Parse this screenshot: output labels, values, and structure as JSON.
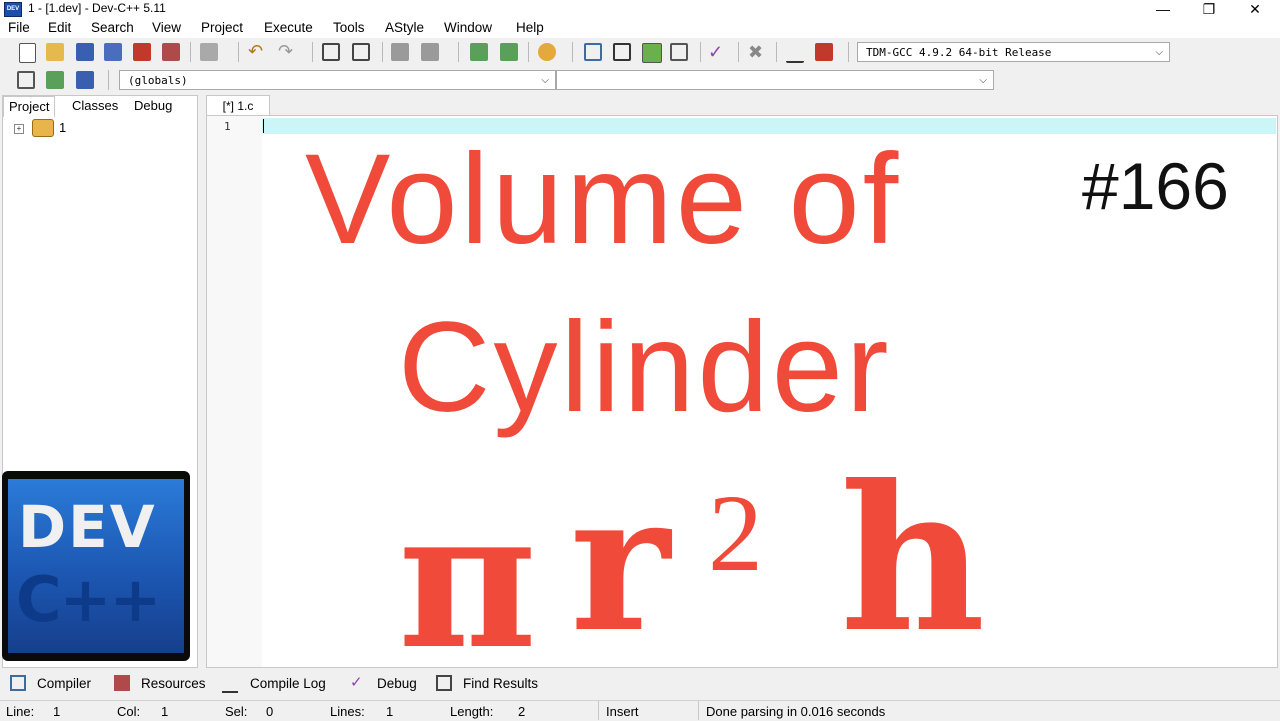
{
  "window": {
    "title": "1 - [1.dev] - Dev-C++ 5.11",
    "minimize_glyph": "—",
    "restore_glyph": "❐",
    "close_glyph": "✕"
  },
  "menu": [
    "File",
    "Edit",
    "Search",
    "View",
    "Project",
    "Execute",
    "Tools",
    "AStyle",
    "Window",
    "Help"
  ],
  "toolbar": {
    "compiler_select": "TDM-GCC 4.9.2 64-bit Release",
    "scope_select": "(globals)",
    "member_select": ""
  },
  "left_panel": {
    "tabs": [
      "Project",
      "Classes",
      "Debug"
    ],
    "tree": {
      "expander": "+",
      "label": "1"
    },
    "logo_text": "DEV",
    "logo_text_2": "C++"
  },
  "editor": {
    "tab_label": "[*] 1.c",
    "line_number": "1"
  },
  "overlay": {
    "line1": "Volume of",
    "line2": "Cylinder",
    "formula_pi": "π",
    "formula_r": "r",
    "formula_sup": "2",
    "formula_h": "h",
    "episode": "#166"
  },
  "bottom_tabs": [
    "Compiler",
    "Resources",
    "Compile Log",
    "Debug",
    "Find Results"
  ],
  "status": {
    "line_label": "Line:",
    "line_value": "1",
    "col_label": "Col:",
    "col_value": "1",
    "sel_label": "Sel:",
    "sel_value": "0",
    "lines_label": "Lines:",
    "lines_value": "1",
    "length_label": "Length:",
    "length_value": "2",
    "mode": "Insert",
    "message": "Done parsing in 0.016 seconds"
  },
  "colors": {
    "overlay_red": "#f04a3a",
    "current_line": "#ccf5f7",
    "logo_blue": "#1c57b2"
  }
}
